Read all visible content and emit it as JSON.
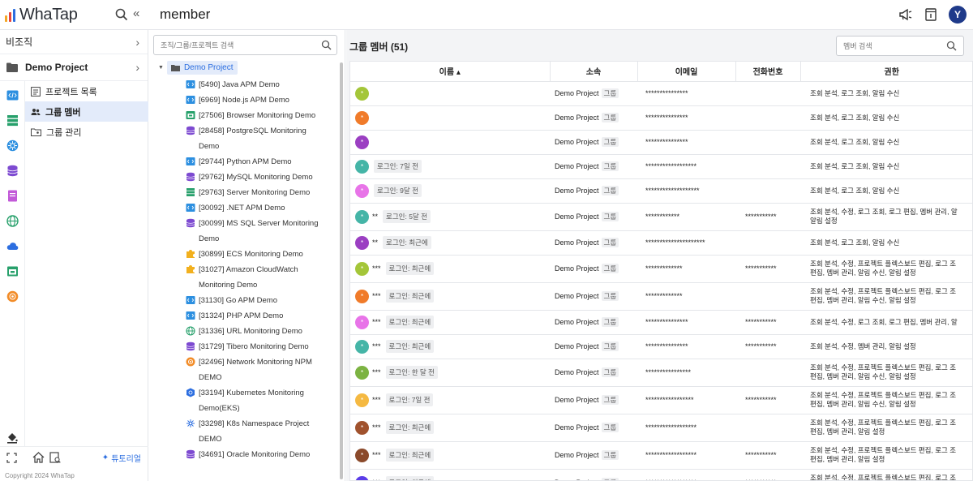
{
  "app": {
    "logo_text": "WhaTap",
    "page_title": "member"
  },
  "colors": {
    "accent": "#2c6ee0",
    "active_bg": "#e3ebfa",
    "avatar": "#1f3a8a"
  },
  "top_right": {
    "avatar_letter": "Y",
    "icons": [
      "megaphone-icon",
      "document-icon"
    ]
  },
  "nav": {
    "org_label": "비조직",
    "project_label": "Demo Project",
    "items": [
      {
        "label": "프로젝트 목록",
        "icon": "list-icon"
      },
      {
        "label": "그룹 멤버",
        "icon": "users-icon",
        "active": true
      },
      {
        "label": "그룹 관리",
        "icon": "folder-group-icon"
      }
    ],
    "side_icons": [
      "code-icon",
      "server-icon",
      "kubernetes-icon",
      "database-icon",
      "npm-icon",
      "globe-icon",
      "cloud-icon",
      "browser-icon",
      "network-icon"
    ],
    "tutorial_label": "튜토리얼",
    "copyright": "Copyright 2024 WhaTap"
  },
  "tree": {
    "search_placeholder": "조직/그룹/프로젝트 검색",
    "root_label": "Demo Project",
    "items": [
      {
        "label": "[5490] Java APM Demo",
        "icon": "code"
      },
      {
        "label": "[6969] Node.js APM Demo",
        "icon": "code"
      },
      {
        "label": "[27506] Browser Monitoring Demo",
        "icon": "browser"
      },
      {
        "label": "[28458] PostgreSQL Monitoring Demo",
        "icon": "db"
      },
      {
        "label": "[29744] Python APM Demo",
        "icon": "code"
      },
      {
        "label": "[29762] MySQL Monitoring Demo",
        "icon": "db"
      },
      {
        "label": "[29763] Server Monitoring Demo",
        "icon": "server"
      },
      {
        "label": "[30092] .NET APM Demo",
        "icon": "code"
      },
      {
        "label": "[30099] MS SQL Server Monitoring Demo",
        "icon": "db"
      },
      {
        "label": "[30899] ECS Monitoring Demo",
        "icon": "puzzle"
      },
      {
        "label": "[31027] Amazon CloudWatch Monitoring Demo",
        "icon": "puzzle"
      },
      {
        "label": "[31130] Go APM Demo",
        "icon": "code"
      },
      {
        "label": "[31324] PHP APM Demo",
        "icon": "code"
      },
      {
        "label": "[31336] URL Monitoring Demo",
        "icon": "globe"
      },
      {
        "label": "[31729] Tibero Monitoring Demo",
        "icon": "db"
      },
      {
        "label": "[32496] Network Monitoring NPM DEMO",
        "icon": "network"
      },
      {
        "label": "[33194] Kubernetes Monitoring Demo(EKS)",
        "icon": "k8s"
      },
      {
        "label": "[33298] K8s Namespace Project DEMO",
        "icon": "k8s-ns"
      },
      {
        "label": "[34691] Oracle Monitoring Demo",
        "icon": "db"
      }
    ]
  },
  "main": {
    "title": "그룹 멤버 (51)",
    "search_placeholder": "멤버 검색",
    "columns": [
      "이름 ▴",
      "소속",
      "이메일",
      "전화번호",
      "권한"
    ],
    "rows": [
      {
        "color": "#a4c639",
        "name": "",
        "login": "",
        "org": "Demo Project",
        "tag": "그룹",
        "email": "***************",
        "phone": "",
        "perm": [
          "조회 분석, 로그 조회, 알림 수신"
        ]
      },
      {
        "color": "#f07b2a",
        "name": "",
        "login": "",
        "org": "Demo Project",
        "tag": "그룹",
        "email": "***************",
        "phone": "",
        "perm": [
          "조회 분석, 로그 조회, 알림 수신"
        ]
      },
      {
        "color": "#9b3fc2",
        "name": "",
        "login": "",
        "org": "Demo Project",
        "tag": "그룹",
        "email": "***************",
        "phone": "",
        "perm": [
          "조회 분석, 로그 조회, 알림 수신"
        ]
      },
      {
        "color": "#45b5a7",
        "name": "",
        "login": "로그인: 7일 전",
        "org": "Demo Project",
        "tag": "그룹",
        "email": "******************",
        "phone": "",
        "perm": [
          "조회 분석, 로그 조회, 알림 수신"
        ]
      },
      {
        "color": "#e874e8",
        "name": "",
        "login": "로그인: 9달 전",
        "org": "Demo Project",
        "tag": "그룹",
        "email": "*******************",
        "phone": "",
        "perm": [
          "조회 분석, 로그 조회, 알림 수신"
        ]
      },
      {
        "color": "#45b5a7",
        "name": "**",
        "login": "로그인: 5달 전",
        "org": "Demo Project",
        "tag": "그룹",
        "email": "************",
        "phone": "***********",
        "perm": [
          "조회 분석, 수정, 로그 조회, 로그 편집, 멤버 관리, 알",
          "알림 설정"
        ]
      },
      {
        "color": "#9b3fc2",
        "name": "**",
        "login": "로그인: 최근에",
        "org": "Demo Project",
        "tag": "그룹",
        "email": "*********************",
        "phone": "",
        "perm": [
          "조회 분석, 로그 조회, 알림 수신"
        ]
      },
      {
        "color": "#a4c639",
        "name": "***",
        "login": "로그인: 최근에",
        "org": "Demo Project",
        "tag": "그룹",
        "email": "*************",
        "phone": "***********",
        "perm": [
          "조회 분석, 수정, 프로젝트 플렉스보드 편집, 로그 조",
          "편집, 멤버 관리, 알림 수신, 알림 설정"
        ]
      },
      {
        "color": "#f07b2a",
        "name": "***",
        "login": "로그인: 최근에",
        "org": "Demo Project",
        "tag": "그룹",
        "email": "*************",
        "phone": "",
        "perm": [
          "조회 분석, 수정, 프로젝트 플렉스보드 편집, 로그 조",
          "편집, 멤버 관리, 알림 수신, 알림 설정"
        ]
      },
      {
        "color": "#e874e8",
        "name": "***",
        "login": "로그인: 최근에",
        "org": "Demo Project",
        "tag": "그룹",
        "email": "***************",
        "phone": "***********",
        "perm": [
          "조회 분석, 수정, 로그 조회, 로그 편집, 멤버 관리, 알"
        ]
      },
      {
        "color": "#45b5a7",
        "name": "***",
        "login": "로그인: 최근에",
        "org": "Demo Project",
        "tag": "그룹",
        "email": "***************",
        "phone": "***********",
        "perm": [
          "조회 분석, 수정, 멤버 관리, 알림 설정"
        ]
      },
      {
        "color": "#7cb342",
        "name": "***",
        "login": "로그인: 한 달 전",
        "org": "Demo Project",
        "tag": "그룹",
        "email": "****************",
        "phone": "",
        "perm": [
          "조회 분석, 수정, 프로젝트 플렉스보드 편집, 로그 조",
          "편집, 멤버 관리, 알림 수신, 알림 설정"
        ]
      },
      {
        "color": "#f5b942",
        "name": "***",
        "login": "로그인: 7일 전",
        "org": "Demo Project",
        "tag": "그룹",
        "email": "*****************",
        "phone": "***********",
        "perm": [
          "조회 분석, 수정, 프로젝트 플렉스보드 편집, 로그 조",
          "편집, 멤버 관리, 알림 수신, 알림 설정"
        ]
      },
      {
        "color": "#a0522d",
        "name": "***",
        "login": "로그인: 최근에",
        "org": "Demo Project",
        "tag": "그룹",
        "email": "******************",
        "phone": "",
        "perm": [
          "조회 분석, 수정, 프로젝트 플렉스보드 편집, 로그 조",
          "편집, 멤버 관리, 알림 설정"
        ]
      },
      {
        "color": "#8b4a2b",
        "name": "***",
        "login": "로그인: 최근에",
        "org": "Demo Project",
        "tag": "그룹",
        "email": "******************",
        "phone": "***********",
        "perm": [
          "조회 분석, 수정, 프로젝트 플렉스보드 편집, 로그 조",
          "편집, 멤버 관리, 알림 설정"
        ]
      },
      {
        "color": "#5b3ce8",
        "name": "***",
        "login": "로그인: 최근에",
        "org": "Demo Project",
        "tag": "그룹",
        "email": "******************",
        "phone": "***********",
        "perm": [
          "조회 분석, 수정, 프로젝트 플렉스보드 편집, 로그 조",
          "편집, 멤버 관리, 알림 설정"
        ]
      }
    ]
  }
}
